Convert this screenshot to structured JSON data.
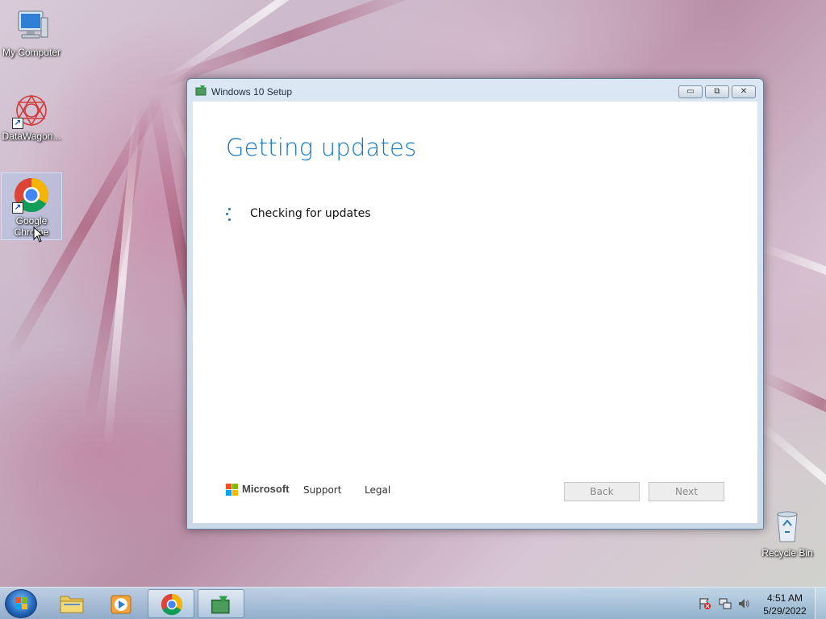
{
  "desktop": {
    "icons": [
      {
        "label": "My Computer"
      },
      {
        "label": "DataWagon..."
      },
      {
        "label": "Google Chrome"
      }
    ],
    "recycle_bin": {
      "label": "Recycle Bin"
    }
  },
  "window": {
    "title": "Windows 10 Setup",
    "controls": {
      "minimize": "▭",
      "restore": "⧉",
      "close": "✕"
    },
    "heading": "Getting updates",
    "status": "Checking for updates",
    "footer": {
      "brand": "Microsoft",
      "links": [
        "Support",
        "Legal"
      ],
      "back_label": "Back",
      "next_label": "Next"
    }
  },
  "taskbar": {
    "items": [
      "start-orb",
      "windows-explorer",
      "media-player",
      "google-chrome",
      "windows-10-setup"
    ],
    "active_item": "google-chrome",
    "time": "4:51 AM",
    "date": "5/29/2022"
  },
  "colors": {
    "accent": "#1479c2",
    "ms_red": "#f25022",
    "ms_green": "#7fba00",
    "ms_blue": "#00a4ef",
    "ms_yellow": "#ffb900"
  }
}
